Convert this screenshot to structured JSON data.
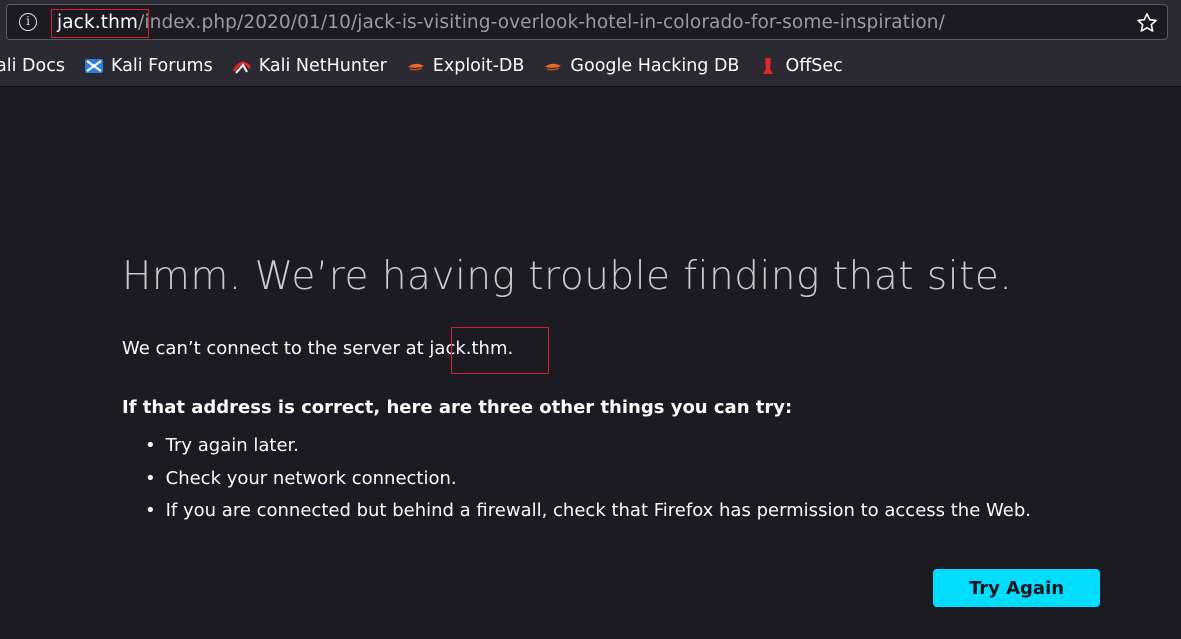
{
  "browser": {
    "url_host": "jack.thm",
    "url_path": "/index.php/2020/01/10/jack-is-visiting-overlook-hotel-in-colorado-for-some-inspiration/",
    "info_glyph": "i",
    "bookmarks": [
      {
        "label": "ali Docs",
        "icon": "kali-docs-icon"
      },
      {
        "label": "Kali Forums",
        "icon": "kali-forums-icon"
      },
      {
        "label": "Kali NetHunter",
        "icon": "kali-nethunter-icon"
      },
      {
        "label": "Exploit-DB",
        "icon": "exploit-db-icon"
      },
      {
        "label": "Google Hacking DB",
        "icon": "google-hacking-db-icon"
      },
      {
        "label": "OffSec",
        "icon": "offsec-icon"
      }
    ]
  },
  "error_page": {
    "title": "Hmm. We’re having trouble finding that site.",
    "lede_prefix": "We can’t connect to the server at ",
    "lede_host": "jack.thm",
    "lede_suffix": ".",
    "tips_heading": "If that address is correct, here are three other things you can try:",
    "tips": [
      "Try again later.",
      "Check your network connection.",
      "If you are connected but behind a firewall, check that Firefox has permission to access the Web."
    ],
    "try_again_label": "Try Again"
  },
  "colors": {
    "background": "#1c1b22",
    "toolbar": "#2b2a33",
    "accent_button": "#00ddff",
    "annotation_box": "#d4202a"
  }
}
